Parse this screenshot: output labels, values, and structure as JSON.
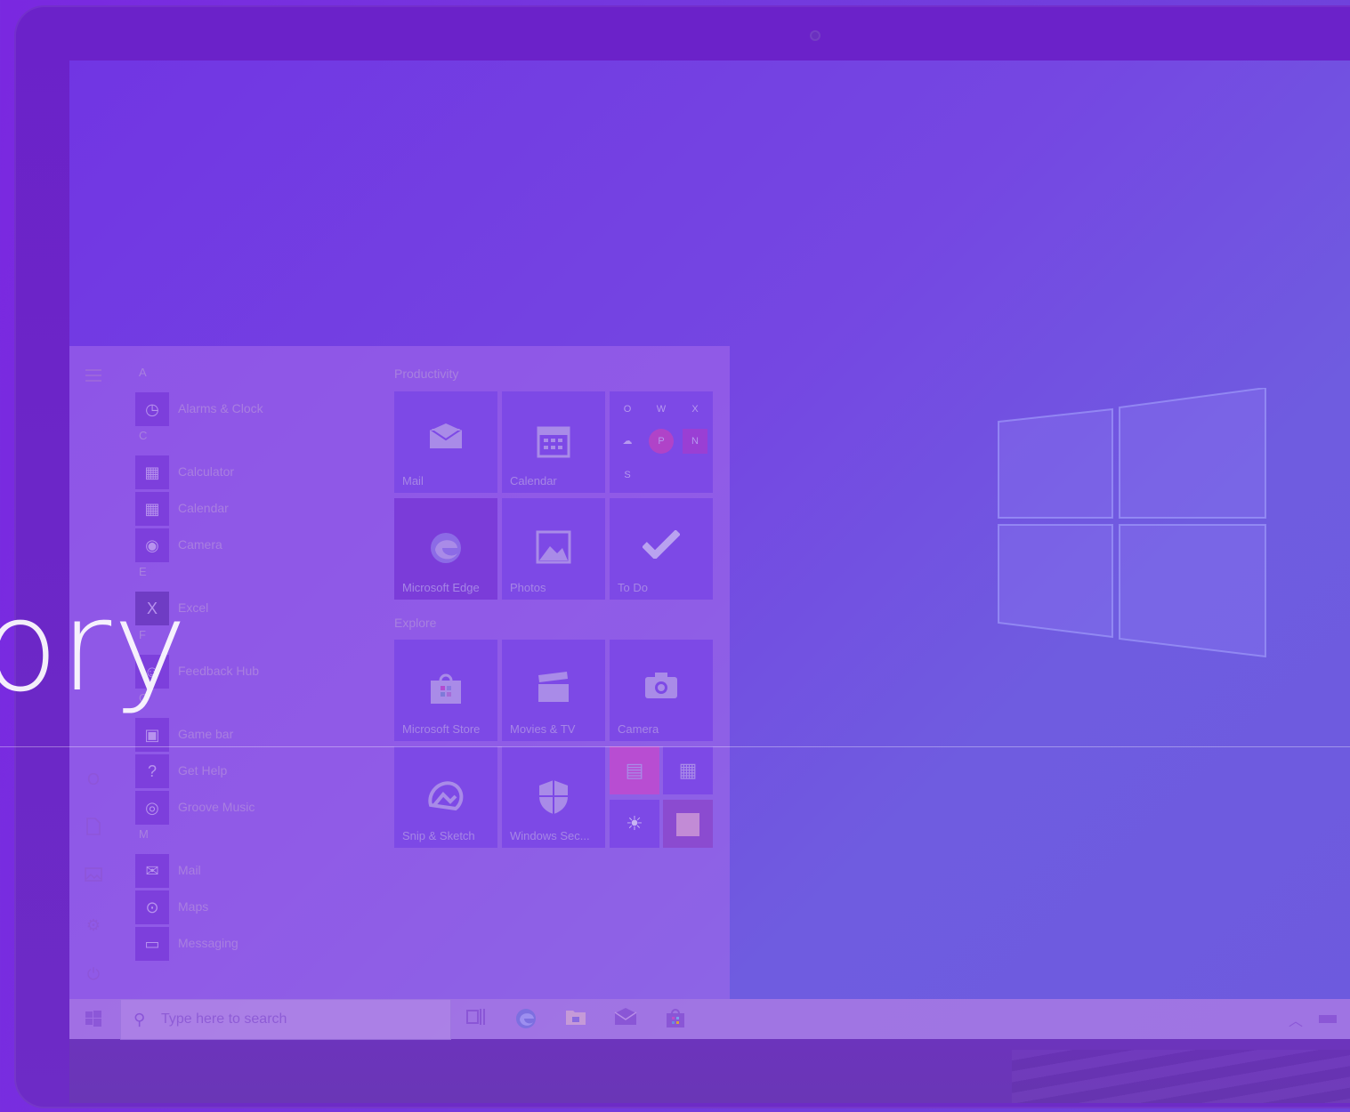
{
  "overlay": {
    "headline_fragment": "ory"
  },
  "start_menu": {
    "app_list": [
      {
        "type": "letter",
        "text": "A"
      },
      {
        "type": "app",
        "name": "Alarms & Clock",
        "icon": "clock-icon"
      },
      {
        "type": "letter",
        "text": "C"
      },
      {
        "type": "app",
        "name": "Calculator",
        "icon": "calculator-icon"
      },
      {
        "type": "app",
        "name": "Calendar",
        "icon": "calendar-icon"
      },
      {
        "type": "app",
        "name": "Camera",
        "icon": "camera-icon"
      },
      {
        "type": "letter",
        "text": "E"
      },
      {
        "type": "app",
        "name": "Excel",
        "icon": "excel-icon"
      },
      {
        "type": "letter",
        "text": "F"
      },
      {
        "type": "app",
        "name": "Feedback Hub",
        "icon": "feedback-icon"
      },
      {
        "type": "letter",
        "text": "G"
      },
      {
        "type": "app",
        "name": "Game bar",
        "icon": "gamebar-icon"
      },
      {
        "type": "app",
        "name": "Get Help",
        "icon": "help-icon"
      },
      {
        "type": "app",
        "name": "Groove Music",
        "icon": "music-icon"
      },
      {
        "type": "letter",
        "text": "M"
      },
      {
        "type": "app",
        "name": "Mail",
        "icon": "mail-icon"
      },
      {
        "type": "app",
        "name": "Maps",
        "icon": "maps-icon"
      },
      {
        "type": "app",
        "name": "Messaging",
        "icon": "messaging-icon"
      }
    ],
    "groups": {
      "productivity": {
        "title": "Productivity",
        "tiles": {
          "mail": "Mail",
          "calendar": "Calendar",
          "edge": "Microsoft Edge",
          "photos": "Photos",
          "todo": "To Do"
        },
        "office_letters": [
          "O",
          "W",
          "X",
          "",
          "P",
          "N",
          "S"
        ]
      },
      "explore": {
        "title": "Explore",
        "tiles": {
          "store": "Microsoft Store",
          "movies": "Movies & TV",
          "camera": "Camera",
          "snip": "Snip & Sketch",
          "security": "Windows Sec..."
        }
      }
    }
  },
  "taskbar": {
    "search_placeholder": "Type here to search"
  },
  "colors": {
    "background": "#7433de",
    "start_menu": "#a66ceb",
    "tile": "#7d49e6",
    "taskbar": "#b07ee4"
  }
}
